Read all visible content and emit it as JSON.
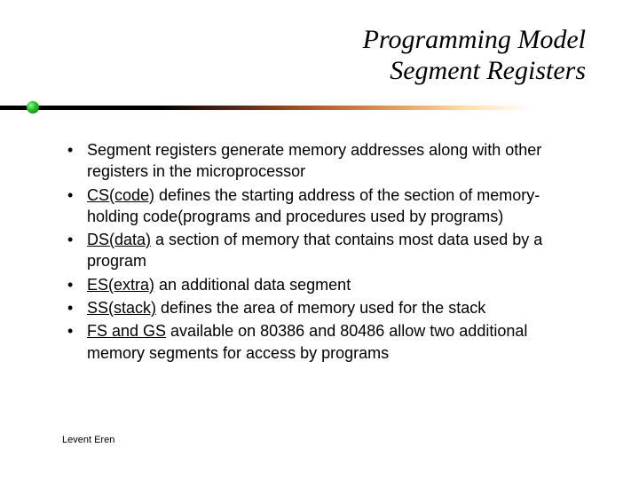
{
  "title": {
    "line1": "Programming Model",
    "line2": "Segment Registers"
  },
  "bullets": [
    {
      "label": "",
      "text": "Segment registers generate memory addresses along with other registers in the microprocessor"
    },
    {
      "label": "CS(code)",
      "text": " defines the starting address of the section of memory-holding code(programs and procedures used by programs)"
    },
    {
      "label": "DS(data)",
      "text": " a section of memory that contains most data used by a program"
    },
    {
      "label": "ES(extra)",
      "text": " an additional data segment"
    },
    {
      "label": "SS(stack)",
      "text": " defines the area of memory used for the stack"
    },
    {
      "label": "FS and GS",
      "text": " available on 80386 and 80486 allow two additional memory segments for access by programs"
    }
  ],
  "footer": "Levent Eren"
}
